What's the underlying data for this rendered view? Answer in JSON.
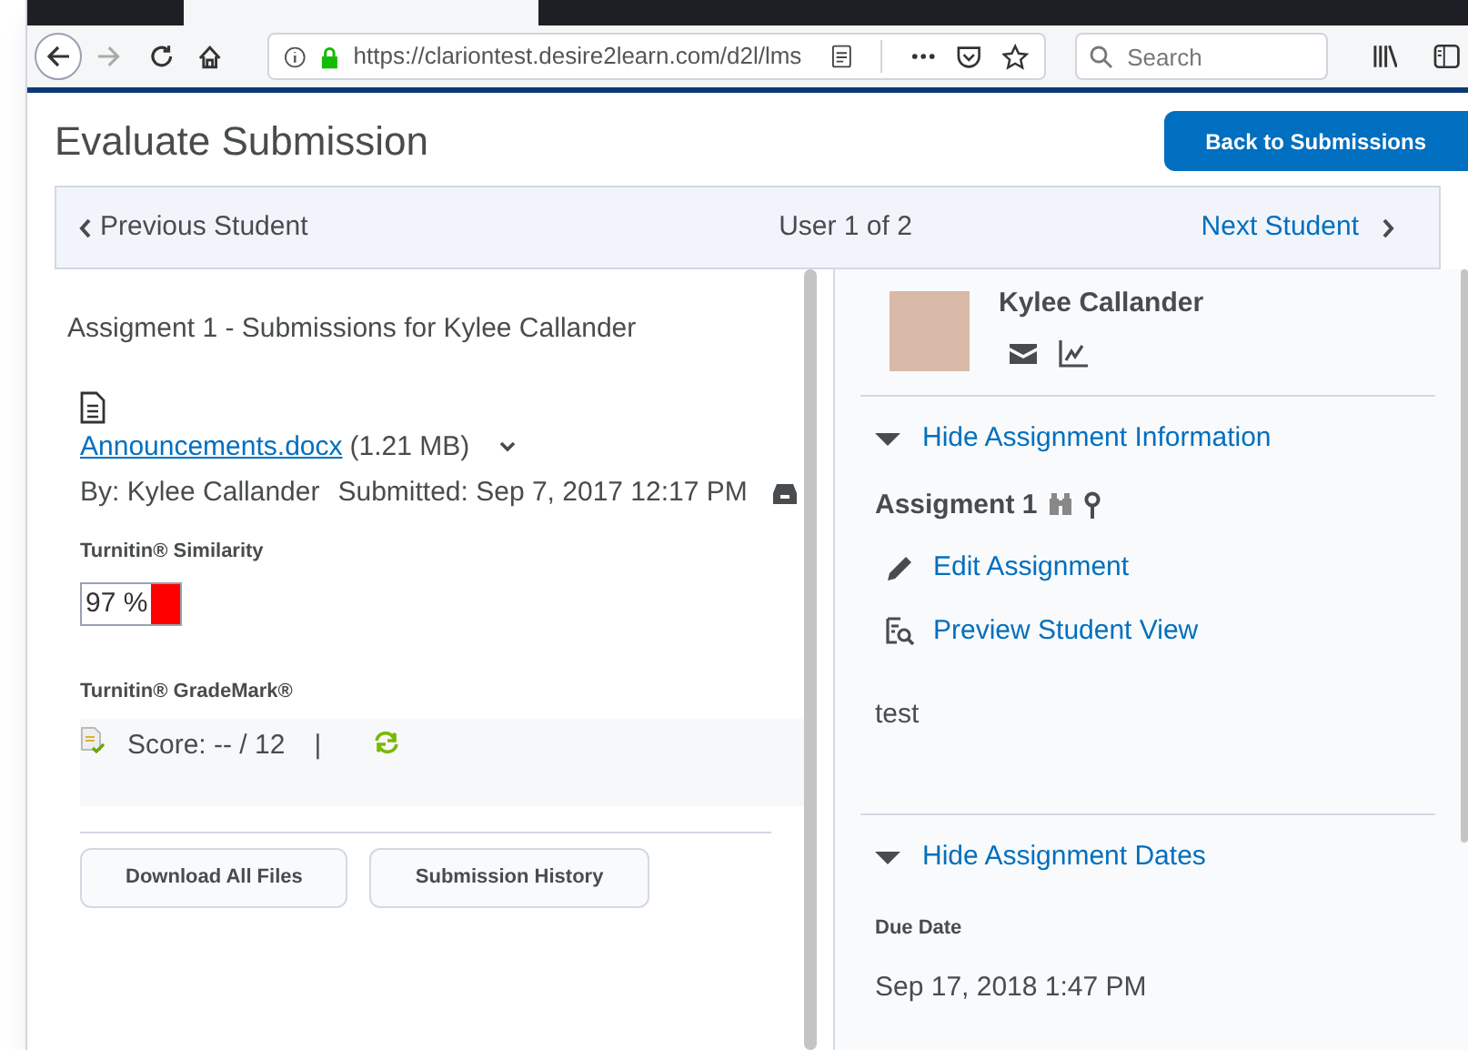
{
  "browser": {
    "url": "https://clariontest.desire2learn.com/d2l/lms",
    "search_placeholder": "Search"
  },
  "header": {
    "title": "Evaluate Submission",
    "back_button": "Back to Submissions"
  },
  "navigation": {
    "previous": "Previous Student",
    "position": "User 1 of 2",
    "next": "Next Student"
  },
  "submission": {
    "heading": "Assigment 1 - Submissions for Kylee Callander",
    "file": {
      "name": "Announcements.docx",
      "size": "(1.21 MB)"
    },
    "by": "By: Kylee Callander",
    "submitted": "Submitted: Sep 7, 2017 12:17 PM",
    "similarity": {
      "label": "Turnitin® Similarity",
      "score": "97 %",
      "color": "#ff0000"
    },
    "grademark": {
      "label": "Turnitin® GradeMark®",
      "score": "Score: -- / 12",
      "separator": "|"
    },
    "buttons": [
      "Download All Files",
      "Submission History"
    ]
  },
  "student": {
    "name": "Kylee Callander"
  },
  "assignment_info": {
    "toggle": "Hide Assignment Information",
    "expanded": true,
    "title": "Assigment 1",
    "actions": [
      {
        "kind": "edit",
        "label": "Edit Assignment"
      },
      {
        "kind": "preview",
        "label": "Preview Student View"
      }
    ],
    "description": "test"
  },
  "assignment_dates": {
    "toggle": "Hide Assignment Dates",
    "expanded": true,
    "due_label": "Due Date",
    "due_date": "Sep 17, 2018 1:47 PM"
  }
}
